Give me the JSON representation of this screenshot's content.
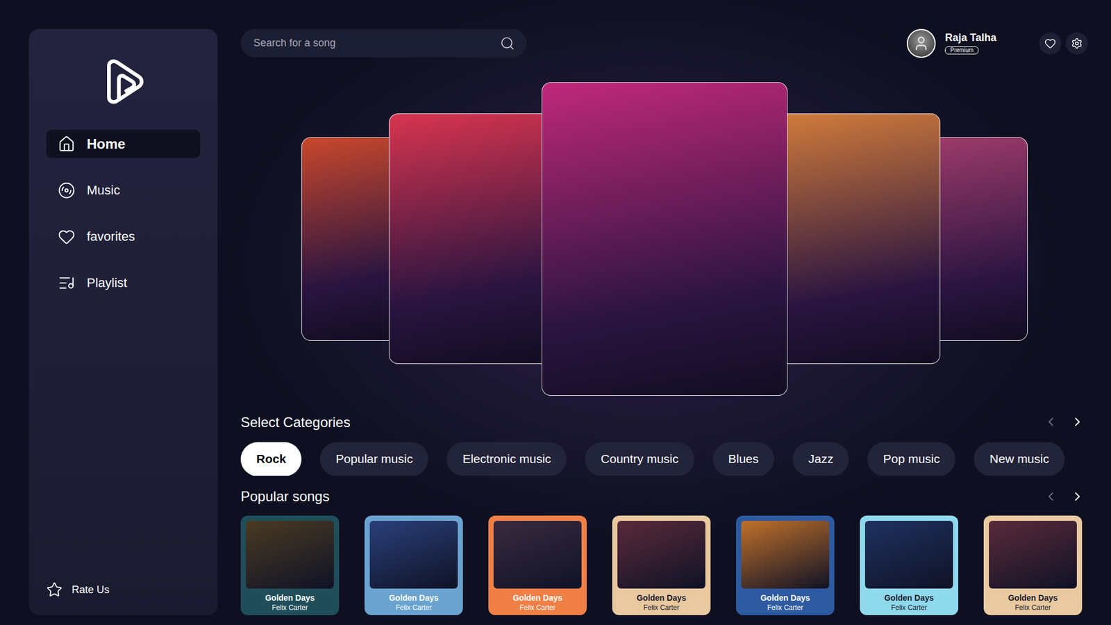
{
  "search": {
    "placeholder": "Search for a song"
  },
  "user": {
    "name": "Raja Talha",
    "badge": "Premium"
  },
  "sidebar": {
    "items": [
      {
        "label": "Home",
        "selected": true
      },
      {
        "label": "Music",
        "selected": false
      },
      {
        "label": "favorites",
        "selected": false
      },
      {
        "label": "Playlist",
        "selected": false
      }
    ],
    "footer": "Rate Us"
  },
  "carousel": {
    "slides": [
      {
        "selected": false,
        "color": "#c8472c"
      },
      {
        "selected": false,
        "color": "#d8344f"
      },
      {
        "selected": true,
        "color": "#c0287a"
      },
      {
        "selected": false,
        "color": "#cf7a3a"
      },
      {
        "selected": false,
        "color": "#9b3a6a"
      }
    ]
  },
  "categories": {
    "title": "Select Categories",
    "items": [
      {
        "label": "Rock",
        "selected": true
      },
      {
        "label": "Popular music",
        "selected": false
      },
      {
        "label": "Electronic music",
        "selected": false
      },
      {
        "label": "Country music",
        "selected": false
      },
      {
        "label": "Blues",
        "selected": false
      },
      {
        "label": "Jazz",
        "selected": false
      },
      {
        "label": "Pop music",
        "selected": false
      },
      {
        "label": "New music",
        "selected": false
      }
    ]
  },
  "popular": {
    "title": "Popular songs",
    "songs": [
      {
        "title": "Golden Days",
        "artist": "Felix Carter",
        "color": "#1f4e5a",
        "art": "#4a3a22"
      },
      {
        "title": "Golden Days",
        "artist": "Felix Carter",
        "color": "#6aa3d0",
        "art": "#2a3f7a"
      },
      {
        "title": "Golden Days",
        "artist": "Felix Carter",
        "color": "#ef7f45",
        "art": "#3a2a40"
      },
      {
        "title": "Golden Days",
        "artist": "Felix Carter",
        "color": "#e8c9a0",
        "art": "#5a2a3a"
      },
      {
        "title": "Golden Days",
        "artist": "Felix Carter",
        "color": "#2d5aa0",
        "art": "#c0702a"
      },
      {
        "title": "Golden Days",
        "artist": "Felix Carter",
        "color": "#8fd9ec",
        "art": "#1e3160"
      },
      {
        "title": "Golden Days",
        "artist": "Felix Carter",
        "color": "#e8c9a0",
        "art": "#5a2a3a"
      }
    ]
  }
}
